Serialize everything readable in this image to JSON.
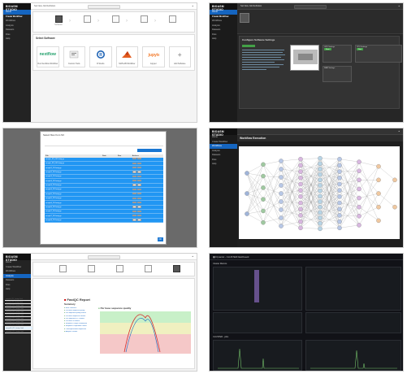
{
  "app": {
    "brand": "BIOASM STUDIO"
  },
  "panel1": {
    "sidebar": [
      "Home",
      "Create Workflow",
      "Workflows",
      "Analysis",
      "Datasets",
      "Files",
      "Help"
    ],
    "topbar": "Set New Job Definition",
    "wizard_steps": [
      "Software",
      "",
      "",
      "",
      "",
      ""
    ],
    "section_title": "Select Software",
    "cards": [
      {
        "logo": "nextflow",
        "caption": "Run Nextflow Workflow"
      },
      {
        "logo": "",
        "caption": "Custom Tools"
      },
      {
        "logo": "",
        "caption": "R Studio"
      },
      {
        "logo": "",
        "caption": "MATLAB Workflow"
      },
      {
        "logo": "",
        "caption": "Jupyter"
      },
      {
        "logo": "+",
        "caption": "Add Software"
      }
    ]
  },
  "panel2": {
    "topbar": "Set New Job Definition",
    "brand": "BIOASM STUDIO",
    "sidebar": [
      "Home",
      "Create Workflow",
      "Workflows",
      "Analysis",
      "Datasets",
      "Files",
      "Help"
    ],
    "config_title": "Configure Software Settings",
    "options": [
      "GPU Settings",
      "CPU Settings",
      "RAM Settings"
    ],
    "buttons": [
      "Save",
      "Next"
    ]
  },
  "panel3": {
    "modal_title": "Select files from S3",
    "columns": [
      "File",
      "Date",
      "Size",
      "Actions"
    ],
    "rows": [
      "sample_R1_001.fastq.gz",
      "sample_R2_001.fastq.gz",
      "sample2_R1.fastq.gz",
      "sample2_R2.fastq.gz",
      "sample3_R1.fastq.gz",
      "sample3_R2.fastq.gz",
      "sample4_R1.fastq.gz",
      "sample4_R2.fastq.gz",
      "sample5_R1.fastq.gz",
      "sample5_R2.fastq.gz",
      "sample6_R1.fastq.gz",
      "sample6_R2.fastq.gz",
      "sample7_R1.fastq.gz",
      "sample7_R2.fastq.gz",
      "sample8_R1.fastq.gz"
    ],
    "ok": "OK"
  },
  "panel4": {
    "brand": "BIOASM STUDIO",
    "title": "Workflow Execution",
    "sidebar": [
      "Home",
      "Create Workflow",
      "Workflows",
      "Analysis",
      "Datasets",
      "Files",
      "Help"
    ]
  },
  "panel5": {
    "sidebar": [
      "Home",
      "Create Workflow",
      "Workflows",
      "Analysis",
      "Datasets",
      "Files",
      "Help"
    ],
    "report_title": "FastQC Report",
    "summary_label": "Summary",
    "chart_title": "Per base sequence quality",
    "files": [
      "sample_R1_fastqc.html",
      "sample_R2_fastqc.html",
      "sample2_R1_fastqc.html",
      "sample2_R2_fastqc.html",
      "sample3_R1_fastqc.html",
      "sample3_R2_fastqc.html",
      "sample4_R1_fastqc.html",
      "sample4_R2_fastqc.html",
      "sample5_R1_fastqc.html",
      "sample5_R2_fastqc.html",
      "sample6_R1_fastqc.html"
    ],
    "summary_items": [
      "Basic Statistics",
      "Per base sequence quality",
      "Per sequence quality scores",
      "Per base sequence content",
      "Per sequence GC content",
      "Per base N content",
      "Sequence Length Distribution",
      "Sequence Duplication Levels",
      "Overrepresented sequences",
      "Adapter Content"
    ]
  },
  "panel6": {
    "title": "Dynamic - CLUSTER Dashboard",
    "row1": "Cluster Metrics",
    "row2": "CLUSTER - jobs"
  },
  "colors": {
    "accent": "#1565c0",
    "success": "#43a047",
    "dark": "#232323"
  }
}
